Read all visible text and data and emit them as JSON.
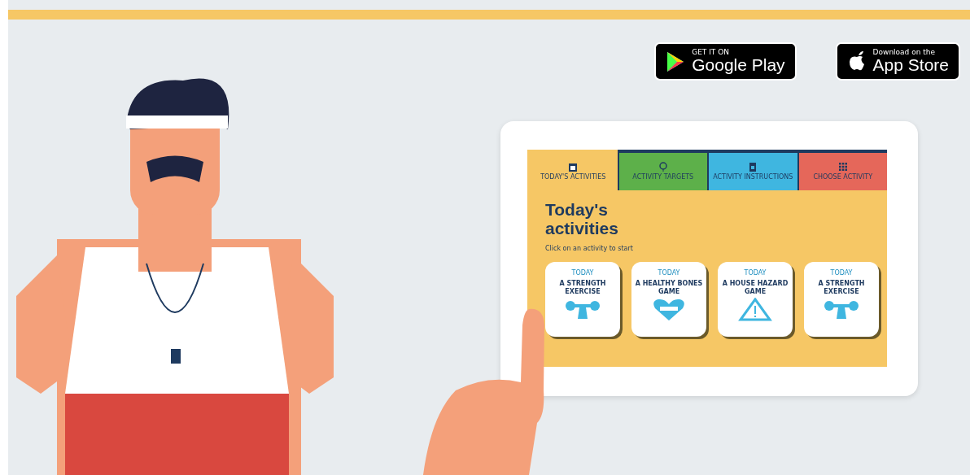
{
  "store_badges": [
    {
      "kind": "google",
      "small": "GET IT ON",
      "big": "Google Play"
    },
    {
      "kind": "apple",
      "small": "Download on the",
      "big": "App Store"
    }
  ],
  "tablet": {
    "tabs": [
      {
        "kind": "calendar",
        "label": "TODAY'S ACTIVITIES",
        "color": "#f6c765",
        "selected": true
      },
      {
        "kind": "target",
        "label": "ACTIVITY TARGETS",
        "color": "#5db04a",
        "selected": false
      },
      {
        "kind": "clipboard",
        "label": "ACTIVITY INSTRUCTIONS",
        "color": "#3fb6e0",
        "selected": false
      },
      {
        "kind": "grid",
        "label": "CHOOSE ACTIVITY",
        "color": "#e5675a",
        "selected": false
      }
    ],
    "heading": "Today's activities",
    "subtitle": "Click on an activity to start",
    "cards": [
      {
        "kind": "dumbbell",
        "tag": "TODAY",
        "title": "A STRENGTH EXERCISE"
      },
      {
        "kind": "heart",
        "tag": "TODAY",
        "title": "A HEALTHY BONES GAME"
      },
      {
        "kind": "warning",
        "tag": "TODAY",
        "title": "A HOUSE HAZARD GAME"
      },
      {
        "kind": "dumbbell",
        "tag": "TODAY",
        "title": "A STRENGTH EXERCISE"
      }
    ]
  }
}
